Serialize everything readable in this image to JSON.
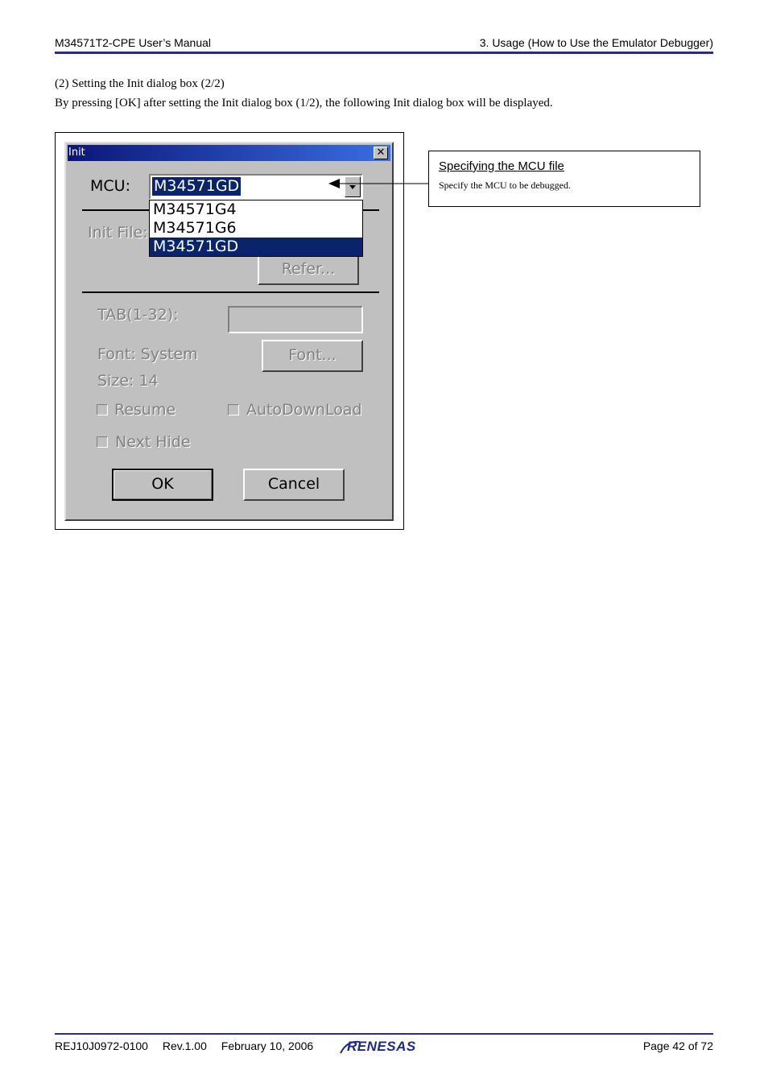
{
  "header": {
    "left": "M34571T2-CPE User’s Manual",
    "right": "3. Usage (How to Use the Emulator Debugger)"
  },
  "body": {
    "heading": "(2) Setting the Init dialog box (2/2)",
    "paragraph": "By pressing [OK] after setting the Init dialog box (1/2), the following Init dialog box will be displayed."
  },
  "dialog": {
    "title": "Init",
    "close_glyph": "✕",
    "mcu_label": "MCU:",
    "mcu_value": "M34571GD",
    "mcu_options": [
      "M34571G4",
      "M34571G6",
      "M34571GD"
    ],
    "selected_option_index": 2,
    "init_file_label": "Init File:",
    "refer_button": "Refer...",
    "tab_label": "TAB(1-32):",
    "tab_value": "",
    "font_label": "Font: System",
    "size_label": "Size:  14",
    "font_button": "Font...",
    "resume_label": "Resume",
    "autodownload_label": "AutoDownLoad",
    "nexthide_label": "Next Hide",
    "ok_button": "OK",
    "cancel_button": "Cancel"
  },
  "callout": {
    "title": "Specifying the MCU file",
    "body": "Specify the MCU to be debugged."
  },
  "footer": {
    "doc_id": "REJ10J0972-0100",
    "revision": "Rev.1.00",
    "date": "February 10, 2006",
    "logo": "RENESAS",
    "page": "Page 42 of 72"
  },
  "colors": {
    "rule": "#2b2f7a",
    "title_bar_start": "#0a1678",
    "title_bar_end": "#3a6ee0",
    "selection": "#0a246a",
    "dialog_face": "#c0c0c0",
    "logo": "#1d2a86"
  }
}
